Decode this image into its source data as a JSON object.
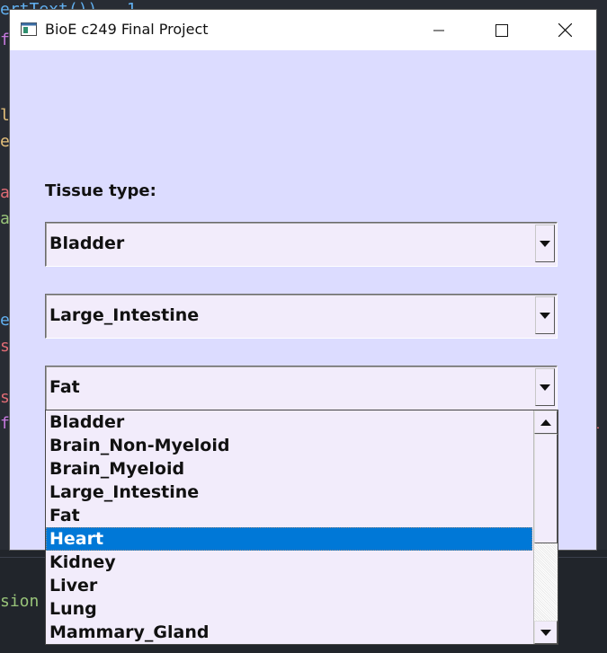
{
  "window": {
    "title": "BioE c249 Final Project",
    "icon": "app-window-icon"
  },
  "label": "Tissue type:",
  "combos": [
    {
      "value": "Bladder"
    },
    {
      "value": "Large_Intestine"
    },
    {
      "value": "Fat"
    }
  ],
  "dropdown": {
    "options": [
      "Bladder",
      "Brain_Non-Myeloid",
      "Brain_Myeloid",
      "Large_Intestine",
      "Fat",
      "Heart",
      "Kidney",
      "Liver",
      "Lung",
      "Mammary_Gland"
    ],
    "highlighted": "Heart"
  },
  "colors": {
    "window_bg": "#dcdcff",
    "field_bg": "#f2ecfb",
    "selection": "#0078d7"
  }
}
